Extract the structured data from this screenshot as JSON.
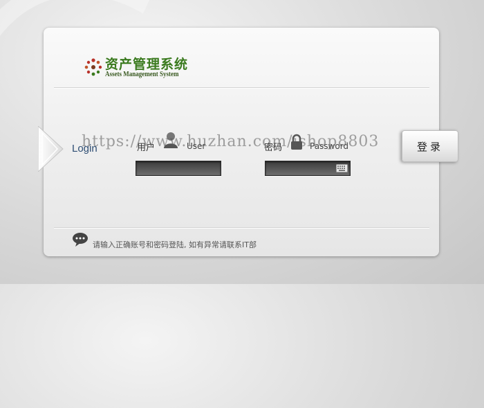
{
  "header": {
    "logo_title": "资产管理系统",
    "logo_subtitle": "Assets Management System"
  },
  "login": {
    "section_label": "Login",
    "username_label_cn": "用户",
    "username_label_en": "User",
    "password_label_cn": "密码",
    "password_label_en": "Password",
    "username_value": "",
    "password_value": "",
    "submit_label": "登录"
  },
  "footer": {
    "tip": "请输入正确账号和密码登陆, 如有异常请联系IT部"
  },
  "watermark": "https://www.huzhan.com/ishop8803",
  "colors": {
    "brand_green": "#3a7a1e",
    "login_blue": "#2d4d73",
    "logo_dots_red": "#b8322a"
  },
  "icons": [
    "logo-dots-icon",
    "user-icon",
    "lock-icon",
    "keyboard-icon",
    "chat-bubble-icon"
  ]
}
